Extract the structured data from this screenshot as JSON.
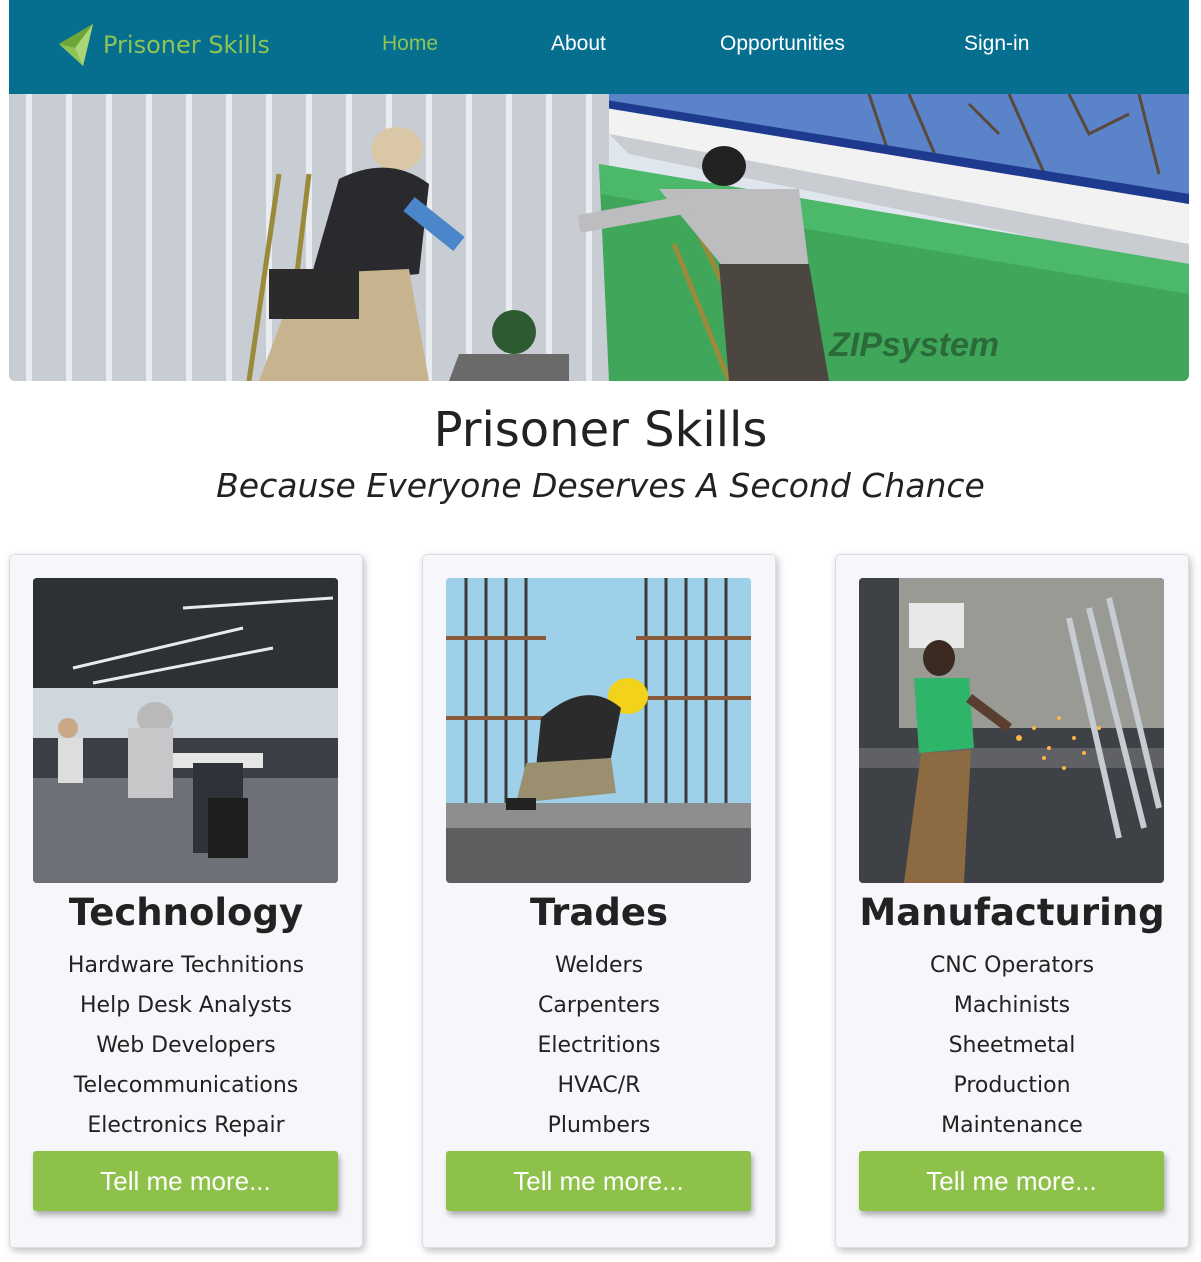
{
  "brand": {
    "name": "Prisoner Skills",
    "logo_icon": "paper-plane-logo-icon",
    "color": "#8dc455"
  },
  "nav": {
    "background": "#066f8f",
    "links": [
      {
        "label": "Home",
        "active": true
      },
      {
        "label": "About",
        "active": false
      },
      {
        "label": "Opportunities",
        "active": false
      },
      {
        "label": "Sign-in",
        "active": false
      }
    ]
  },
  "hero": {
    "image": "construction-workers-installing-siding-photo"
  },
  "heading": {
    "title": "Prisoner Skills",
    "subtitle": "Because Everyone Deserves A Second Chance"
  },
  "cards": [
    {
      "title": "Technology",
      "image": "open-office-computer-lab-photo",
      "items": [
        "Hardware Technitions",
        "Help Desk Analysts",
        "Web Developers",
        "Telecommunications",
        "Electronics Repair"
      ],
      "button": "Tell me more..."
    },
    {
      "title": "Trades",
      "image": "construction-worker-rebar-photo",
      "items": [
        "Welders",
        "Carpenters",
        "Electritions",
        "HVAC/R",
        "Plumbers"
      ],
      "button": "Tell me more..."
    },
    {
      "title": "Manufacturing",
      "image": "metal-grinding-sparks-photo",
      "items": [
        "CNC Operators",
        "Machinists",
        "Sheetmetal",
        "Production",
        "Maintenance"
      ],
      "button": "Tell me more..."
    }
  ],
  "colors": {
    "button": "#8dc149",
    "card_bg": "#f7f7fb"
  }
}
